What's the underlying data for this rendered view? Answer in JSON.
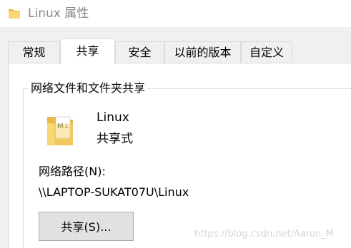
{
  "window": {
    "title": "Linux 属性",
    "icon": "folder-icon"
  },
  "tabs": [
    {
      "label": "常规",
      "active": false
    },
    {
      "label": "共享",
      "active": true
    },
    {
      "label": "安全",
      "active": false
    },
    {
      "label": "以前的版本",
      "active": false
    },
    {
      "label": "自定义",
      "active": false
    }
  ],
  "sharing": {
    "group_title": "网络文件和文件夹共享",
    "folder_icon": "shared-folder-icon",
    "folder_name": "Linux",
    "share_state": "共享式",
    "network_path_label": "网络路径(N):",
    "network_path": "\\\\LAPTOP-SUKAT07U\\Linux",
    "share_button_label": "共享(S)..."
  },
  "watermark": "https://blog.csdn.net/Aaron_M",
  "colors": {
    "folder_yellow": "#f8d775",
    "folder_dark": "#e8b84a",
    "dialog_bg": "#f0f0f0",
    "panel_bg": "#ffffff",
    "title_text": "#8a8a8a"
  }
}
